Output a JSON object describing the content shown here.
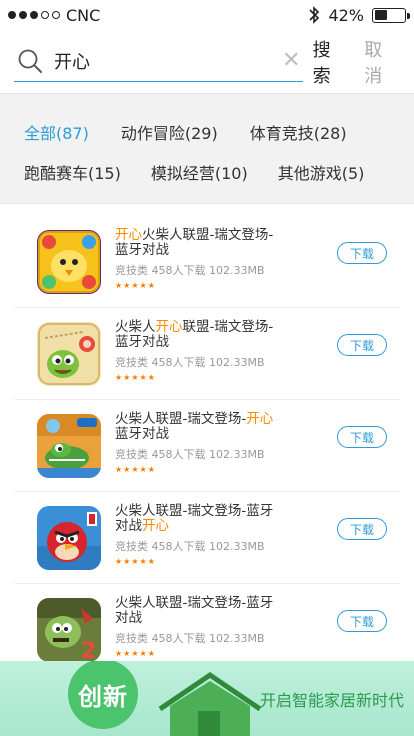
{
  "status_bar": {
    "carrier": "CNC",
    "battery_text": "42%",
    "battery_level": 0.42
  },
  "search": {
    "query": "开心",
    "search_label": "搜索",
    "cancel_label": "取消"
  },
  "categories": {
    "row1": [
      "全部(87)",
      "动作冒险(29)",
      "体育竞技(28)"
    ],
    "row2": [
      "跑酷赛车(15)",
      "模拟经营(10)",
      "其他游戏(5)"
    ],
    "active": "全部(87)"
  },
  "apps": [
    {
      "name_pre": "",
      "name_hl": "开心",
      "name_post": "火柴人联盟-瑞文登场-蓝牙对战",
      "meta": "竞技类 458人下载 102.33MB",
      "stars": "★★★★★",
      "download_label": "下载",
      "icon": "candy-chick-icon"
    },
    {
      "name_pre": "火柴人",
      "name_hl": "开心",
      "name_post": "联盟-瑞文登场-蓝牙对战",
      "meta": "竞技类 458人下载 102.33MB",
      "stars": "★★★★★",
      "download_label": "下载",
      "icon": "cut-the-rope-icon"
    },
    {
      "name_pre": "火柴人联盟-瑞文登场-",
      "name_hl": "开心",
      "name_post": "蓝牙对战",
      "meta": "竞技类 458人下载 102.33MB",
      "stars": "★★★★★",
      "download_label": "下载",
      "icon": "wheres-my-water-icon"
    },
    {
      "name_pre": "火柴人联盟-瑞文登场-蓝牙对战",
      "name_hl": "开心",
      "name_post": "",
      "meta": "竞技类 458人下载 102.33MB",
      "stars": "★★★★★",
      "download_label": "下载",
      "icon": "angry-birds-icon"
    },
    {
      "name_pre": "火柴人联盟-瑞文登场-蓝牙对战",
      "name_hl": "",
      "name_post": "",
      "meta": "竞技类 458人下载 102.33MB",
      "stars": "★★★★★",
      "download_label": "下载",
      "icon": "plants-vs-zombies-icon"
    }
  ],
  "banner": {
    "badge": "创新",
    "slogan": "开启智能家居新时代"
  },
  "colors": {
    "accent": "#2f9bd6",
    "highlight": "#ff8c00",
    "stars": "#ff7a00"
  }
}
